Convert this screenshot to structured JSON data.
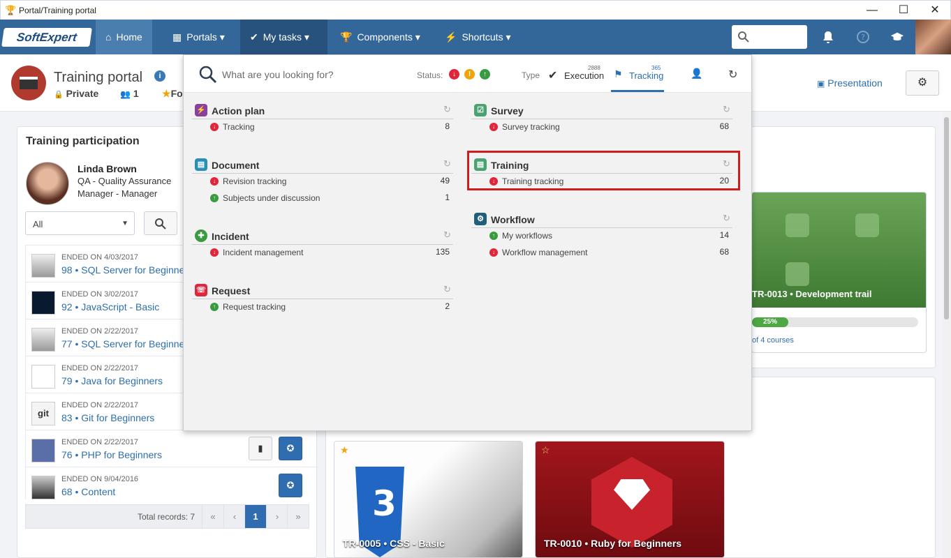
{
  "window": {
    "title": "Portal/Training portal",
    "controls": {
      "min": "—",
      "max": "☐",
      "close": "✕"
    }
  },
  "navbar": {
    "logo": "SoftExpert",
    "items": [
      {
        "label": "Home",
        "icon": "⌂"
      },
      {
        "label": "Portals ▾",
        "icon": "▦"
      },
      {
        "label": "My tasks ▾",
        "icon": "✔"
      },
      {
        "label": "Components ▾",
        "icon": "🏆"
      },
      {
        "label": "Shortcuts ▾",
        "icon": "⚡"
      }
    ]
  },
  "header": {
    "title": "Training portal",
    "info": "i",
    "privacy": "Private",
    "members": "1",
    "favorite": "Fo",
    "presentation": "Presentation"
  },
  "participation": {
    "title": "Training participation",
    "user": {
      "name": "Linda Brown",
      "role1": "QA - Quality Assurance",
      "role2": "Manager - Manager"
    },
    "filter": "All",
    "rows": [
      {
        "ended": "ENDED ON 4/03/2017",
        "name": "98 • SQL Server for Beginners"
      },
      {
        "ended": "ENDED ON 3/02/2017",
        "name": "92 • JavaScript - Basic"
      },
      {
        "ended": "ENDED ON 2/22/2017",
        "name": "77 • SQL Server for Beginners"
      },
      {
        "ended": "ENDED ON 2/22/2017",
        "name": "79 • Java for Beginners"
      },
      {
        "ended": "ENDED ON 2/22/2017",
        "name": "83 • Git for Beginners"
      },
      {
        "ended": "ENDED ON 2/22/2017",
        "name": "76 • PHP for Beginners"
      },
      {
        "ended": "ENDED ON 9/04/2016",
        "name": "68 • Content"
      }
    ],
    "total": "Total records: 7",
    "pager": [
      "«",
      "‹",
      "1",
      "›",
      "»"
    ]
  },
  "cards": [
    {
      "title": "TR-0013 • Development trail",
      "progress": 0.25,
      "progress_label": "25%",
      "count": "of 4 courses"
    },
    {
      "title": "TR-0005 • CSS - Basic",
      "star": "★"
    },
    {
      "title": "TR-0010 • Ruby for Beginners",
      "star": "☆"
    }
  ],
  "dropdown": {
    "search_placeholder": "What are you looking for?",
    "status_label": "Status:",
    "type_label": "Type",
    "execution": {
      "label": "Execution",
      "count": "2888"
    },
    "tracking": {
      "label": "Tracking",
      "count": "365"
    },
    "colors": {
      "red": "#e0263a",
      "orange": "#f0a30a",
      "green": "#3a9a3f"
    },
    "sections": {
      "action_plan": {
        "title": "Action plan",
        "items": [
          {
            "label": "Tracking",
            "count": "8"
          }
        ]
      },
      "document": {
        "title": "Document",
        "items": [
          {
            "label": "Revision tracking",
            "count": "49"
          },
          {
            "label": "Subjects under discussion",
            "count": "1"
          }
        ]
      },
      "incident": {
        "title": "Incident",
        "items": [
          {
            "label": "Incident management",
            "count": "135"
          }
        ]
      },
      "request": {
        "title": "Request",
        "items": [
          {
            "label": "Request tracking",
            "count": "2"
          }
        ]
      },
      "survey": {
        "title": "Survey",
        "items": [
          {
            "label": "Survey tracking",
            "count": "68"
          }
        ]
      },
      "training": {
        "title": "Training",
        "items": [
          {
            "label": "Training tracking",
            "count": "20"
          }
        ]
      },
      "workflow": {
        "title": "Workflow",
        "items": [
          {
            "label": "My workflows",
            "count": "14"
          },
          {
            "label": "Workflow management",
            "count": "68"
          }
        ]
      }
    }
  }
}
